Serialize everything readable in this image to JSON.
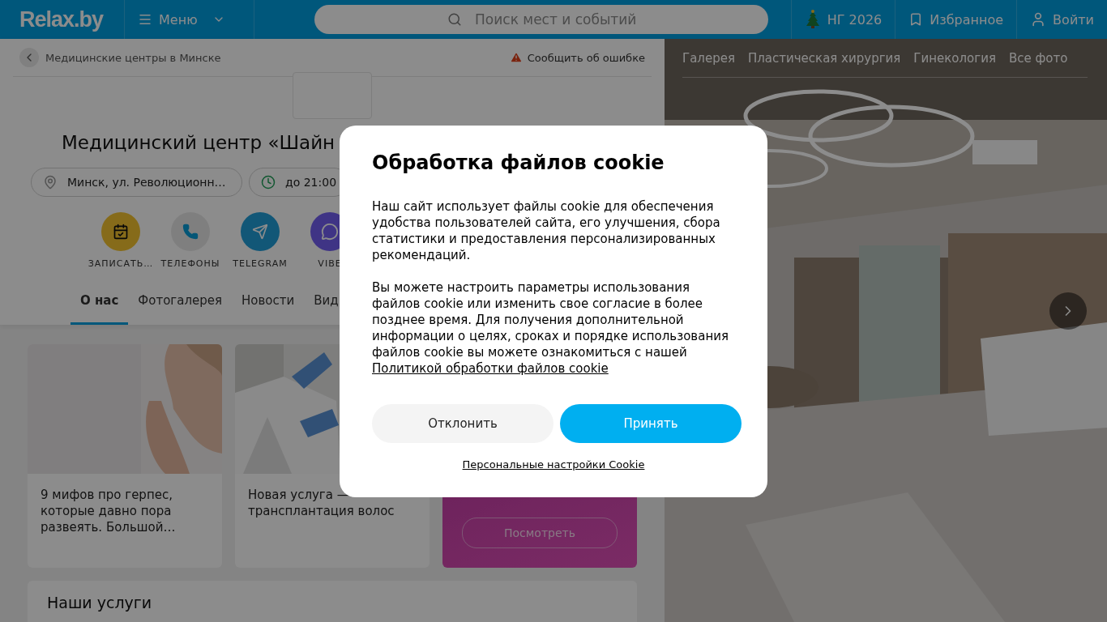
{
  "header": {
    "logo": "Relax.by",
    "menu": "Меню",
    "search": {
      "placeholder": "Поиск мест и событий"
    },
    "actions": [
      {
        "kind": "tree",
        "label": "НГ 2026"
      },
      {
        "kind": "bookmark",
        "label": "Избранное"
      },
      {
        "kind": "user",
        "label": "Войти"
      }
    ]
  },
  "breadcrumb": "Медицинские центры в Минске",
  "report": "Сообщить об ошибке",
  "title": "Медицинский центр «Шайн",
  "address": "Минск, ул. Революционн…",
  "hours": "до 21:00",
  "quick_actions": [
    {
      "kind": "calendar",
      "label": "ЗАПИСАТЬ…"
    },
    {
      "kind": "phone",
      "label": "ТЕЛЕФОНЫ"
    },
    {
      "kind": "telegram",
      "label": "TELEGRAM"
    },
    {
      "kind": "viber",
      "label": "VIBE"
    }
  ],
  "tabs": [
    {
      "label": "О нас",
      "selected": true
    },
    {
      "label": "Фотогалерея",
      "selected": false
    },
    {
      "label": "Новости",
      "selected": false
    },
    {
      "label": "Вид",
      "selected": false
    }
  ],
  "cards": [
    {
      "kind": "article",
      "text": "9 мифов про герпес, которые давно пора развеять. Большой…"
    },
    {
      "kind": "article",
      "text": "Новая услуга — трансплантация волос"
    },
    {
      "kind": "promo",
      "button": "Посмотреть"
    }
  ],
  "services_title": "Наши услуги",
  "gallery": {
    "tabs": [
      "Галерея",
      "Пластическая хирургия",
      "Гинекология",
      "Все фото"
    ]
  },
  "cookie_dialog": {
    "title": "Обработка файлов cookie",
    "paragraphs": [
      "Наш сайт использует файлы cookie для обеспечения удобства пользователей сайта, его улучшения, сбора статистики и предоставления персонализированных рекомендаций.",
      "Вы можете настроить параметры использования файлов cookie или изменить свое согласие в более позднее время. Для получения дополнительной информации о целях, сроках и порядке использования файлов cookie вы можете ознакомиться с нашей"
    ],
    "policy_link": "Политикой обработки файлов cookie",
    "decline": "Отклонить",
    "accept": "Принять",
    "settings_link": "Персональные настройки Cookie"
  }
}
